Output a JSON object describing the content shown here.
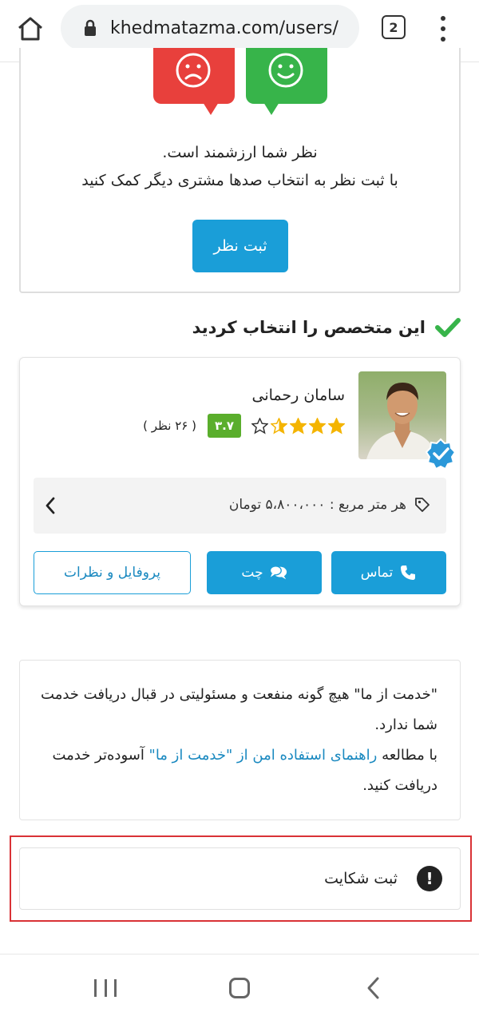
{
  "browser": {
    "url": "khedmatazma.com/users/",
    "tab_count": "2",
    "icons": {
      "home": "home-icon",
      "lock": "lock-icon",
      "menu": "more-vert-icon"
    }
  },
  "feedback": {
    "line1": "نظر شما ارزشمند است.",
    "line2": "با ثبت نظر به انتخاب صدها مشتری دیگر کمک کنید",
    "button_label": "ثبت نظر",
    "colors": {
      "negative": "#e8403c",
      "positive": "#37b44a",
      "accent": "#1a9ed8"
    }
  },
  "selection": {
    "heading": "این متخصص را انتخاب کردید"
  },
  "specialist": {
    "name": "سامان رحمانی",
    "stars": 3.5,
    "rating": "۳.۷",
    "review_count": "( ۲۶ نظر )",
    "price": "هر متر مربع : ۵،۸۰۰،۰۰۰ تومان",
    "buttons": {
      "call": "تماس",
      "chat": "چت",
      "profile": "پروفایل و نظرات"
    },
    "colors": {
      "rating_badge": "#5aae2c",
      "star": "#f4b400"
    }
  },
  "disclaimer": {
    "part1": "\"خدمت از ما\" هیچ گونه منفعت و مسئولیتی در قبال دریافت خدمت شما ندارد.",
    "part2_prefix": "با مطالعه ",
    "part2_link": "راهنمای استفاده امن از \"خدمت از ما\"",
    "part2_suffix": " آسوده‌تر خدمت دریافت کنید."
  },
  "complaint": {
    "label": "ثبت شکایت",
    "icon_glyph": "!"
  }
}
